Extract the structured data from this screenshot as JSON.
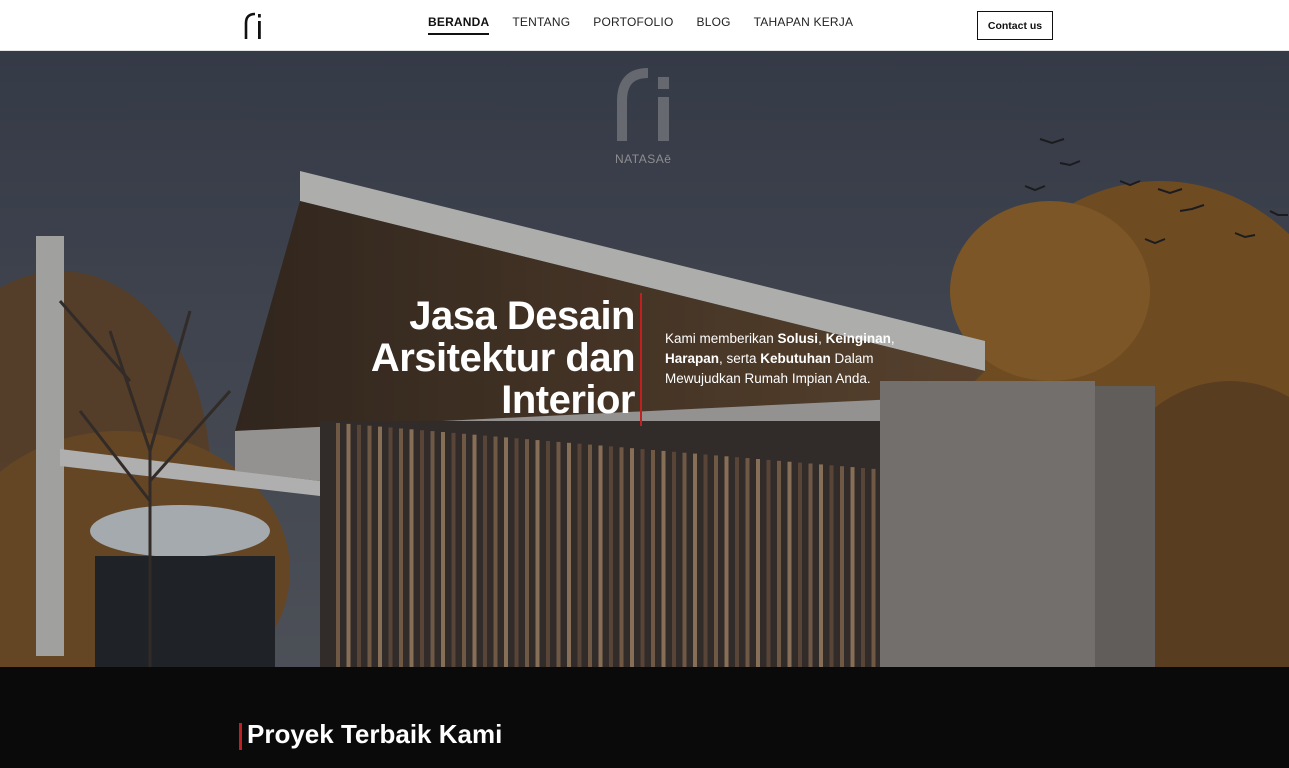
{
  "nav": {
    "logo_icon": "ri-monogram-logo",
    "items": [
      {
        "label": "BERANDA",
        "active": true
      },
      {
        "label": "TENTANG",
        "active": false
      },
      {
        "label": "PORTOFOLIO",
        "active": false
      },
      {
        "label": "BLOG",
        "active": false
      },
      {
        "label": "TAHAPAN KERJA",
        "active": false
      }
    ],
    "contact_label": "Contact us"
  },
  "hero": {
    "watermark_text": "NATASAē",
    "headline": [
      "Jasa Desain",
      "Arsitektur dan",
      "Interior"
    ],
    "sub": {
      "p1": "Kami memberikan ",
      "b1": "Solusi",
      "p2": ", ",
      "b2": "Keinginan",
      "p3": ", ",
      "b3": "Harapan",
      "p4": ", serta ",
      "b4": "Kebutuhan",
      "p5": " Dalam Mewujudkan Rumah Impian Anda."
    }
  },
  "section": {
    "title": "Proyek Terbaik Kami"
  },
  "colors": {
    "accent": "#c0201f",
    "nav_bg": "#ffffff",
    "dark_bg": "#0a0a0a"
  }
}
